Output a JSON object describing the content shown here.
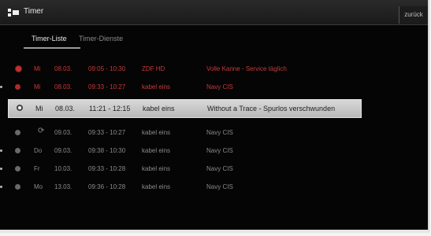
{
  "app": {
    "title": "Timer",
    "back_label": "zurück"
  },
  "tabs": [
    {
      "label": "Timer-Liste"
    },
    {
      "label": "Timer-Dienste"
    }
  ],
  "rows": [
    {
      "status": "recording",
      "day": "Mi",
      "date": "08.03.",
      "time": "09:05 - 10:30",
      "channel": "ZDF HD",
      "show": "Volle Kanne - Service täglich"
    },
    {
      "status": "recording",
      "day": "Mi",
      "date": "08.03.",
      "time": "09:33 - 10:27",
      "channel": "kabel eins",
      "show": "Navy CIS"
    },
    {
      "status": "selected",
      "day": "Mi",
      "date": "08.03.",
      "time": "11:21 - 12:15",
      "channel": "kabel eins",
      "show": "Without a Trace - Spurlos verschwunden"
    },
    {
      "status": "scheduled",
      "day": "",
      "day_icon": "⟳",
      "date": "09.03.",
      "time": "09:33 - 10:27",
      "channel": "kabel eins",
      "show": "Navy CIS"
    },
    {
      "status": "scheduled",
      "day": "Do",
      "date": "09.03.",
      "time": "09:38 - 10:30",
      "channel": "kabel eins",
      "show": "Navy CIS"
    },
    {
      "status": "scheduled",
      "day": "Fr",
      "date": "10.03.",
      "time": "09:33 - 10:28",
      "channel": "kabel eins",
      "show": "Navy CIS"
    },
    {
      "status": "scheduled",
      "day": "Mo",
      "date": "13.03.",
      "time": "09:36 - 10:28",
      "channel": "kabel eins",
      "show": "Navy CIS"
    }
  ],
  "colors": {
    "background": "#050505",
    "recording_text": "#c53a3a",
    "selected_row": "#cfcfcf",
    "normal_text": "#8a8a8a"
  }
}
